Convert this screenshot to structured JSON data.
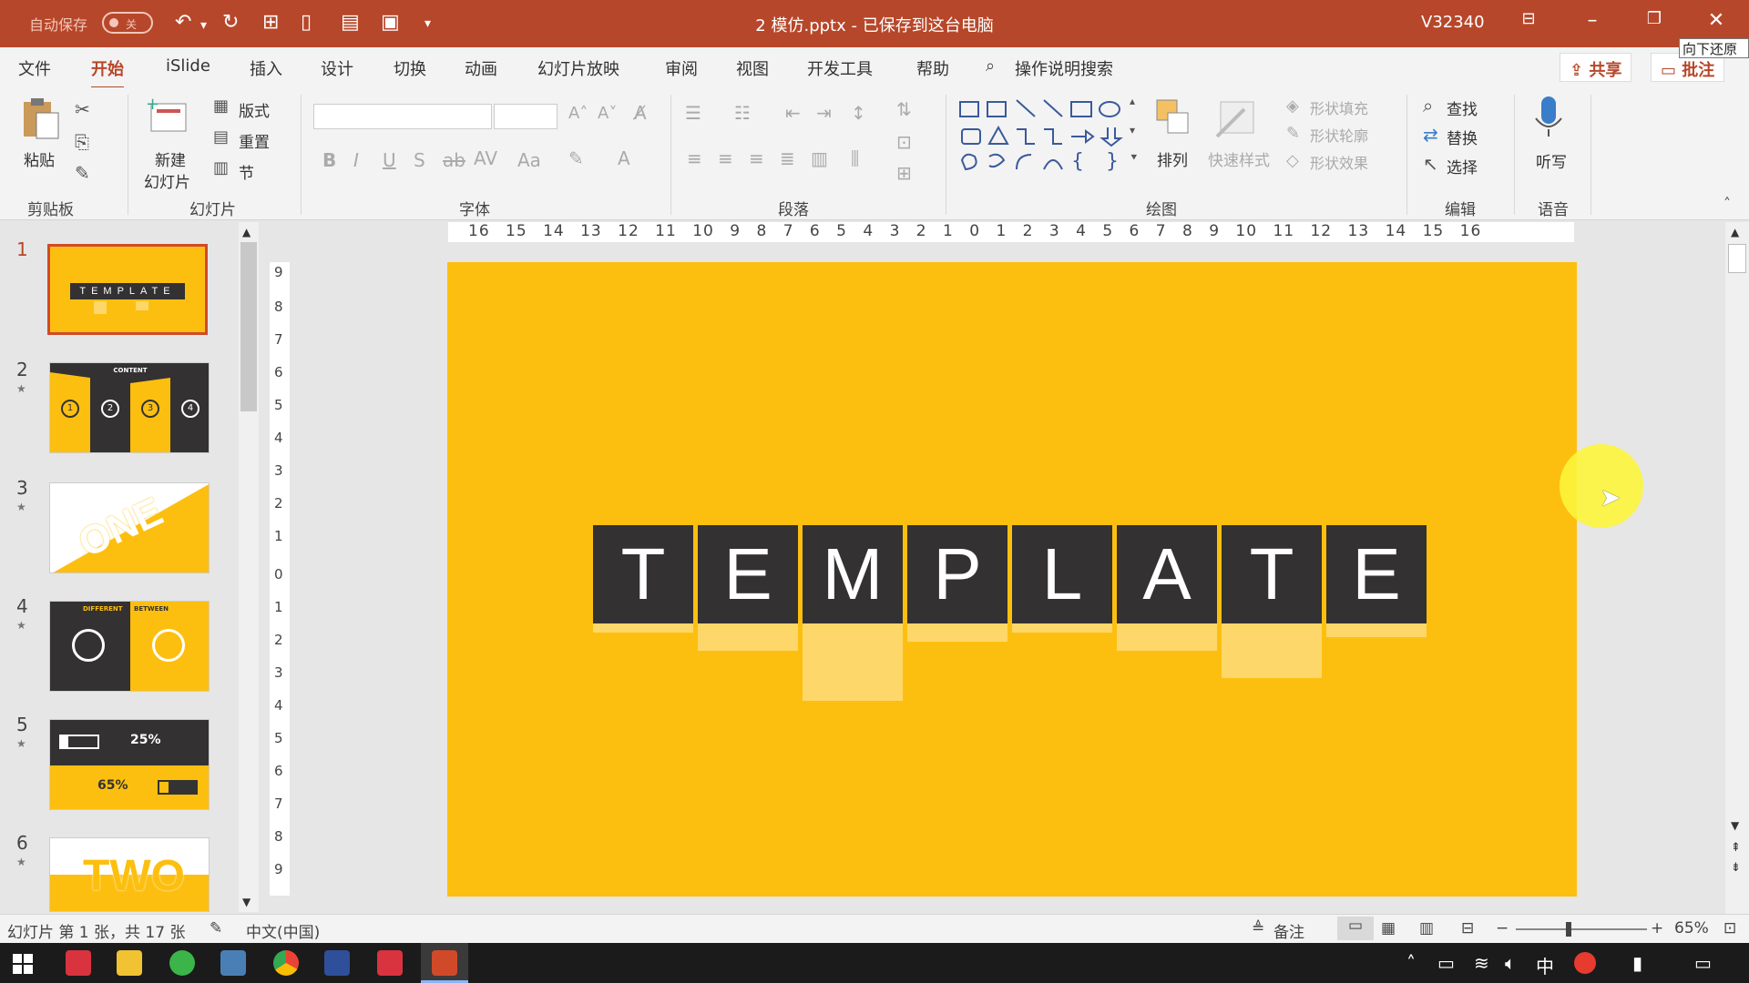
{
  "titlebar": {
    "autosave_label": "自动保存",
    "autosave_state": "关",
    "doc_title": "2 模仿.pptx  -  已保存到这台电脑",
    "user": "V32340",
    "tooltip": "向下还原"
  },
  "menu": {
    "tabs": [
      "文件",
      "开始",
      "iSlide",
      "插入",
      "设计",
      "切换",
      "动画",
      "幻灯片放映",
      "审阅",
      "视图",
      "开发工具",
      "帮助"
    ],
    "active_tab": "开始",
    "search_label": "操作说明搜索",
    "share_label": "共享",
    "comment_label": "批注"
  },
  "ribbon": {
    "clipboard": {
      "paste": "粘贴",
      "label": "剪贴板"
    },
    "slides": {
      "new_slide_1": "新建",
      "new_slide_2": "幻灯片",
      "layout": "版式",
      "reset": "重置",
      "section": "节",
      "label": "幻灯片"
    },
    "font": {
      "label": "字体"
    },
    "paragraph": {
      "label": "段落"
    },
    "drawing": {
      "arrange": "排列",
      "quick_styles": "快速样式",
      "shape_fill": "形状填充",
      "shape_outline": "形状轮廓",
      "shape_effects": "形状效果",
      "label": "绘图"
    },
    "editing": {
      "find": "查找",
      "replace": "替换",
      "select": "选择",
      "label": "编辑"
    },
    "voice": {
      "dictate": "听写",
      "label": "语音"
    }
  },
  "thumbnails": [
    {
      "num": "1",
      "caption": "TEMPLATE"
    },
    {
      "num": "2",
      "caption": "CONTENT"
    },
    {
      "num": "3",
      "caption": "ONE"
    },
    {
      "num": "4",
      "caption_left": "DIFFERENT",
      "caption_right": "BETWEEN"
    },
    {
      "num": "5",
      "pct1": "25%",
      "pct2": "65%"
    },
    {
      "num": "6",
      "caption": "TWO"
    }
  ],
  "thumb2_numbers": [
    "1",
    "2",
    "3",
    "4"
  ],
  "ruler_h": "16 15 14 13 12 11 10 9 8 7 6 5 4 3 2 1 0 1 2 3 4 5 6 7 8 9 10 11 12 13 14 15 16",
  "slide": {
    "letters": [
      "T",
      "E",
      "M",
      "P",
      "L",
      "A",
      "T",
      "E"
    ],
    "bar_levels": [
      0.1,
      0.3,
      0.85,
      0.2,
      0.1,
      0.3,
      0.6,
      0.15
    ],
    "background_color": "#fdbf0f",
    "tile_color": "#333132"
  },
  "statusbar": {
    "slide_info": "幻灯片 第 1 张，共 17 张",
    "language": "中文(中国)",
    "notes": "备注",
    "zoom": "65%"
  },
  "taskbar": {
    "ime": "中"
  }
}
